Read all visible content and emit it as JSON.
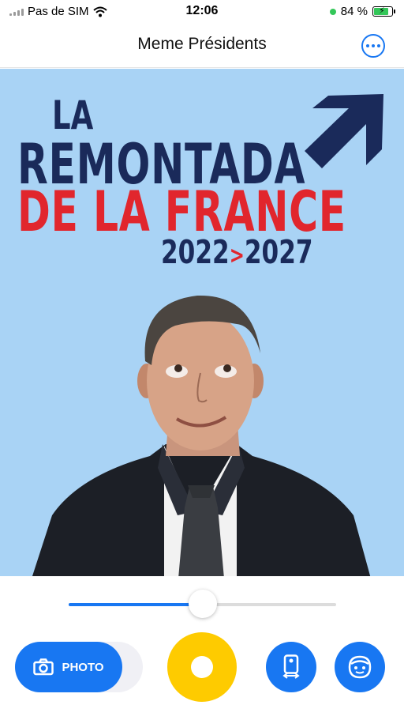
{
  "status_bar": {
    "carrier": "Pas de SIM",
    "time": "12:06",
    "battery_percent": "84 %",
    "battery_level": 0.84
  },
  "nav": {
    "title": "Meme Présidents"
  },
  "poster": {
    "line1": "LA",
    "line2": "REMONTADA",
    "line3": "DE LA FRANCE",
    "year_start": "2022",
    "year_sep": ">",
    "year_end": "2027",
    "colors": {
      "navy": "#1a2a5a",
      "red": "#e1262d",
      "background": "#a9d3f5"
    }
  },
  "controls": {
    "slider_value": 0.5,
    "mode_label": "PHOTO",
    "accent": "#1877f2",
    "shutter_color": "#fecb00",
    "icons": [
      "camera-icon",
      "phone-flip-icon",
      "face-icon",
      "more-icon"
    ]
  }
}
